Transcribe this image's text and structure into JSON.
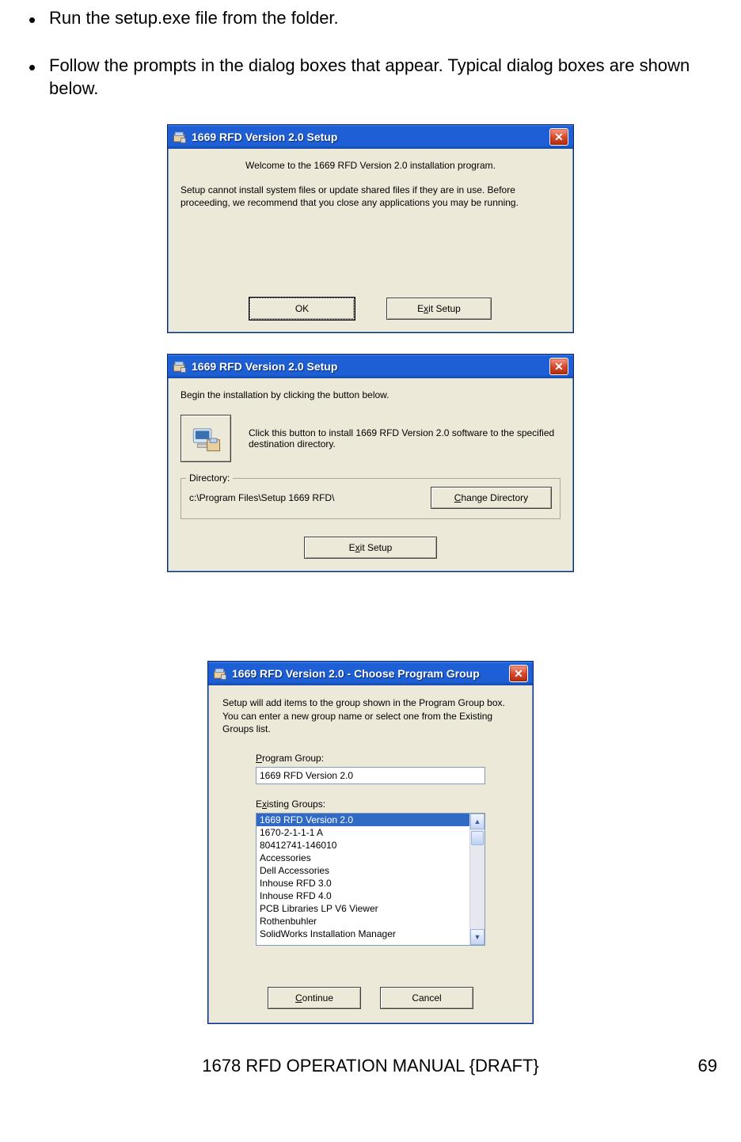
{
  "bullets": [
    "Run the setup.exe file from the folder.",
    "Follow the prompts in the dialog boxes that appear.  Typical dialog boxes are shown below."
  ],
  "dialog1": {
    "title": "1669 RFD Version 2.0 Setup",
    "welcome": "Welcome to the 1669 RFD Version 2.0 installation program.",
    "body": "Setup cannot install system files or update shared files if they are in use. Before proceeding, we recommend that you close any applications you may be running.",
    "ok": "OK",
    "exit_html": "E<span class='u'>x</span>it Setup"
  },
  "dialog2": {
    "title": "1669 RFD Version 2.0 Setup",
    "begin": "Begin the installation by clicking the button below.",
    "help": "Click this button to install 1669 RFD Version 2.0 software to the specified destination directory.",
    "dir_label": "Directory:",
    "dir_path": "c:\\Program Files\\Setup 1669 RFD\\",
    "change_dir_html": "<span class='u'>C</span>hange Directory",
    "exit_html": "E<span class='u'>x</span>it Setup"
  },
  "dialog3": {
    "title": "1669 RFD Version 2.0 - Choose Program Group",
    "intro": "Setup will add items to the group shown in the Program Group box. You can enter a new group name or select one from the Existing Groups list.",
    "pg_label_html": "<span class='u'>P</span>rogram Group:",
    "pg_value": "1669 RFD Version 2.0",
    "eg_label_html": "E<span class='u'>x</span>isting Groups:",
    "groups": [
      "1669 RFD Version 2.0",
      "1670-2-1-1-1 A",
      "80412741-146010",
      "Accessories",
      "Dell Accessories",
      "Inhouse RFD 3.0",
      "Inhouse RFD 4.0",
      "PCB Libraries LP V6 Viewer",
      "Rothenbuhler",
      "SolidWorks Installation Manager"
    ],
    "continue_html": "<span class='u'>C</span>ontinue",
    "cancel": "Cancel"
  },
  "footer": {
    "text": "1678 RFD OPERATION MANUAL {DRAFT}",
    "page": "69"
  }
}
